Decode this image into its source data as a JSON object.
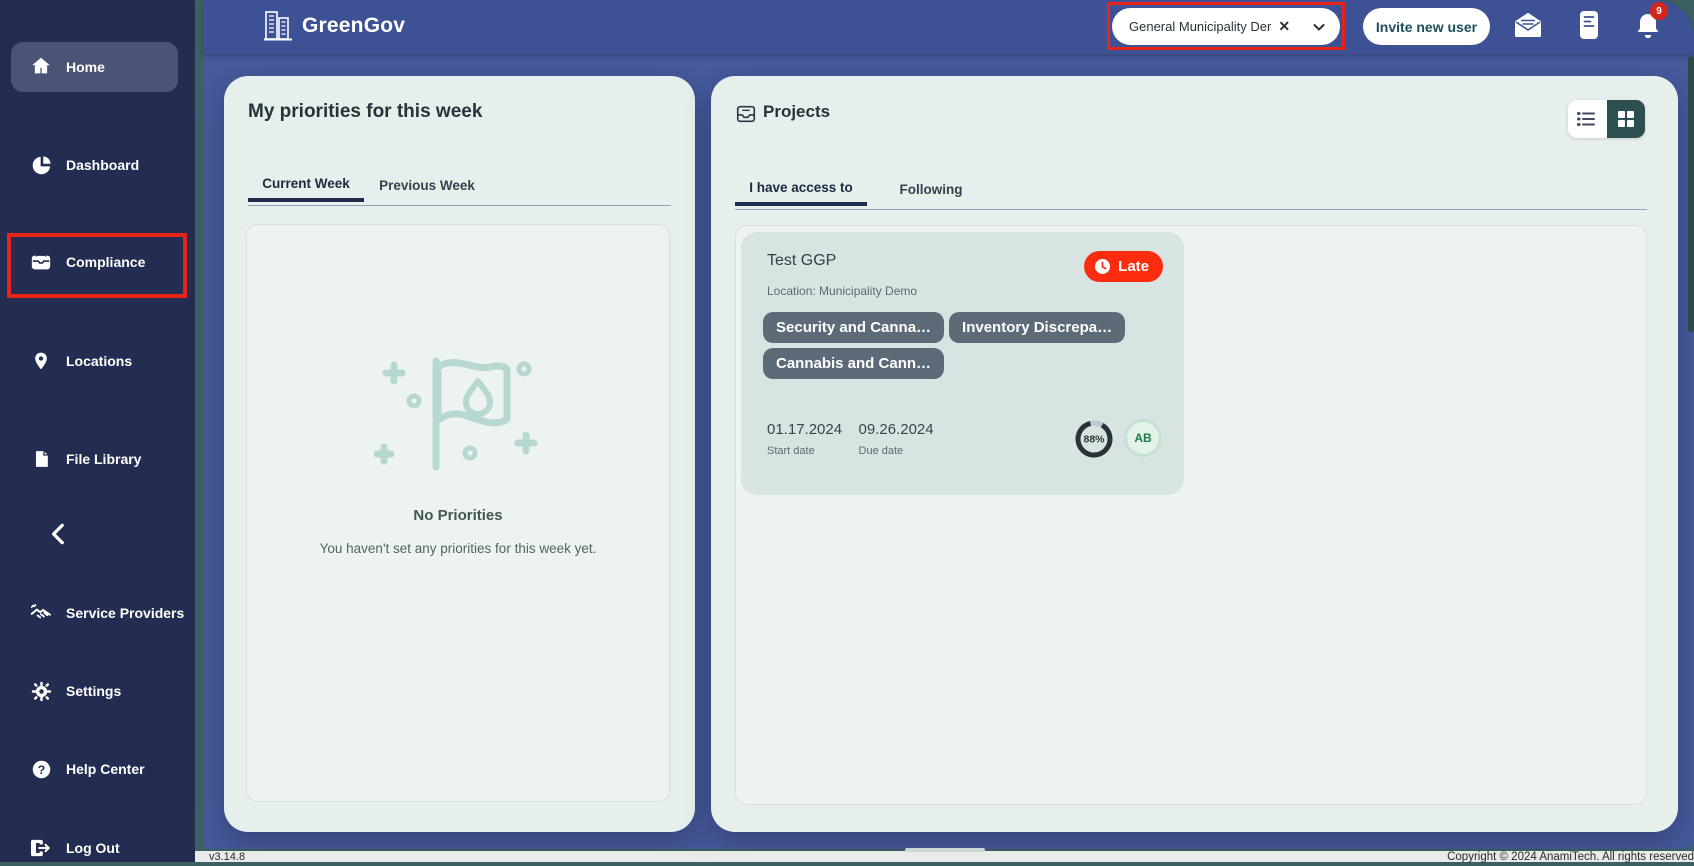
{
  "brand": {
    "name": "GreenGov"
  },
  "header": {
    "org_selector": {
      "value": "General Municipality Der"
    },
    "invite_button_label": "Invite new user",
    "notification_count": "9"
  },
  "icons": {
    "clear_glyph": "✕",
    "help_glyph": "?"
  },
  "sidebar": {
    "items": [
      {
        "label": "Home"
      },
      {
        "label": "Dashboard"
      },
      {
        "label": "Compliance"
      },
      {
        "label": "Locations"
      },
      {
        "label": "File Library"
      },
      {
        "label": "Service Providers"
      },
      {
        "label": "Settings"
      },
      {
        "label": "Help Center"
      },
      {
        "label": "Log Out"
      }
    ]
  },
  "priorities": {
    "title": "My priorities for this week",
    "tabs": [
      "Current Week",
      "Previous Week"
    ],
    "empty_title": "No Priorities",
    "empty_message": "You haven't set any priorities for this week yet."
  },
  "projects": {
    "title": "Projects",
    "tabs": [
      "I have access to",
      "Following"
    ],
    "card": {
      "name": "Test GGP",
      "status": "Late",
      "location": "Location: Municipality Demo",
      "tags": [
        "Security and Canna…",
        "Inventory Discrepa…",
        "Cannabis and Cann…"
      ],
      "start_date": "01.17.2024",
      "start_date_label": "Start date",
      "due_date": "09.26.2024",
      "due_date_label": "Due date",
      "progress_label": "88%",
      "progress_value": 88,
      "avatar_initials": "AB"
    }
  },
  "footer": {
    "version": "v3.14.8",
    "copyright": "Copyright © 2024 AnamiTech. All rights reserved"
  },
  "colors": {
    "annotation_red": "#e8231a",
    "late_badge_red": "#fb2c10",
    "sidebar_navy": "#232d52",
    "content_blue": "#45599b",
    "page_teal": "#3d6163",
    "toggle_teal": "#2e4f52"
  }
}
